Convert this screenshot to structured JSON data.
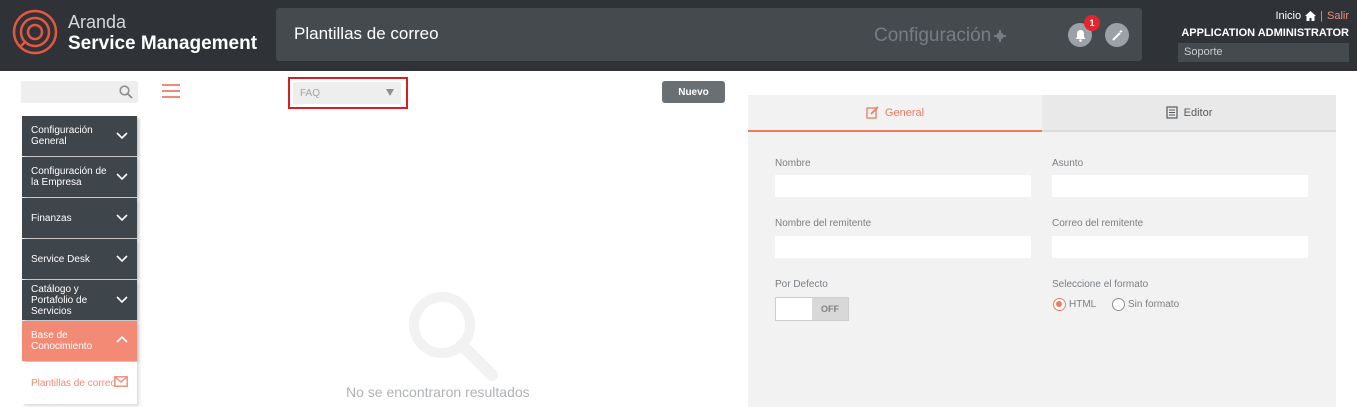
{
  "header": {
    "brand_line1": "Aranda",
    "brand_line2": "Service Management",
    "page_title": "Plantillas de correo",
    "config_label": "Configuración",
    "notification_count": "1",
    "home_link": "Inicio",
    "logout_link": "Salir",
    "user_name": "APPLICATION ADMINISTRATOR",
    "role": "Soporte"
  },
  "sidebar": {
    "search_placeholder": "",
    "items": [
      {
        "label": "Configuración General"
      },
      {
        "label": "Configuración de la Empresa"
      },
      {
        "label": "Finanzas"
      },
      {
        "label": "Service Desk"
      },
      {
        "label": "Catálogo y Portafolio de Servicios"
      },
      {
        "label": "Base de Conocimiento"
      }
    ],
    "subitem": {
      "label": "Plantillas de correo"
    }
  },
  "list": {
    "filter_value": "FAQ",
    "new_button": "Nuevo",
    "empty_message": "No se encontraron resultados"
  },
  "detail": {
    "tabs": [
      {
        "label": "General"
      },
      {
        "label": "Editor"
      }
    ],
    "fields": {
      "nombre_label": "Nombre",
      "asunto_label": "Asunto",
      "remitente_label": "Nombre del remitente",
      "correo_label": "Correo del remitente",
      "defecto_label": "Por Defecto",
      "toggle_state": "OFF",
      "formato_label": "Seleccione el formato",
      "formato_options": [
        "HTML",
        "Sin formato"
      ]
    }
  },
  "colors": {
    "accent": "#ef7a60",
    "topbar": "#2f3337",
    "sidebar": "#3e454b"
  }
}
